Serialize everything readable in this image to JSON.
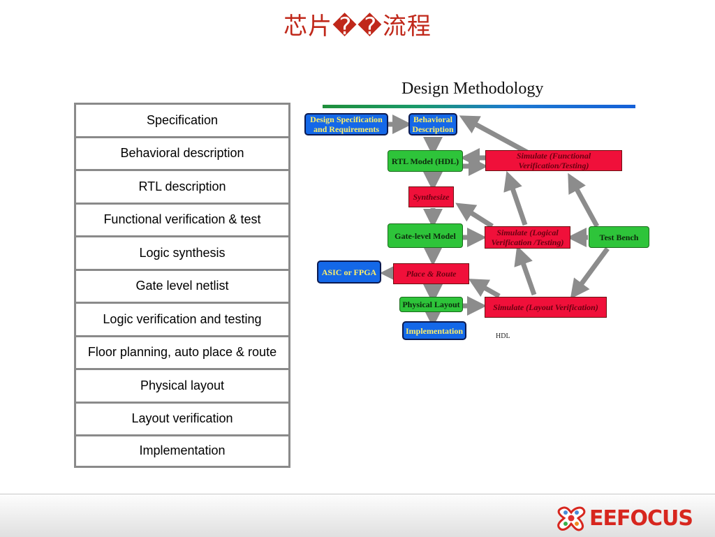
{
  "page": {
    "title": "芯片��流程"
  },
  "flow_steps": [
    "Specification",
    "Behavioral description",
    "RTL description",
    "Functional verification & test",
    "Logic synthesis",
    "Gate level netlist",
    "Logic verification and testing",
    "Floor planning, auto place & route",
    "Physical layout",
    "Layout verification",
    "Implementation"
  ],
  "diagram": {
    "title": "Design Methodology",
    "nodes": {
      "design_spec": "Design Specification and Requirements",
      "behavioral": "Behavioral Description",
      "rtl_model": "RTL Model (HDL)",
      "sim_functional": "Simulate (Functional Verification/Testing)",
      "synthesize": "Synthesize",
      "gate_level": "Gate-level Model",
      "sim_logical": "Simulate (Logical Verification /Testing)",
      "test_bench": "Test Bench",
      "asic_fpga": "ASIC or FPGA",
      "place_route": "Place & Route",
      "physical_layout": "Physical Layout",
      "sim_layout": "Simulate (Layout Verification)",
      "implementation": "Implementation"
    },
    "note": "HDL",
    "colors": {
      "blue": "#1468e8",
      "green": "#2ec43a",
      "red": "#f0103a",
      "arrow": "#8c8c8c"
    }
  },
  "footer": {
    "logo_text": "EEFOCUS"
  }
}
